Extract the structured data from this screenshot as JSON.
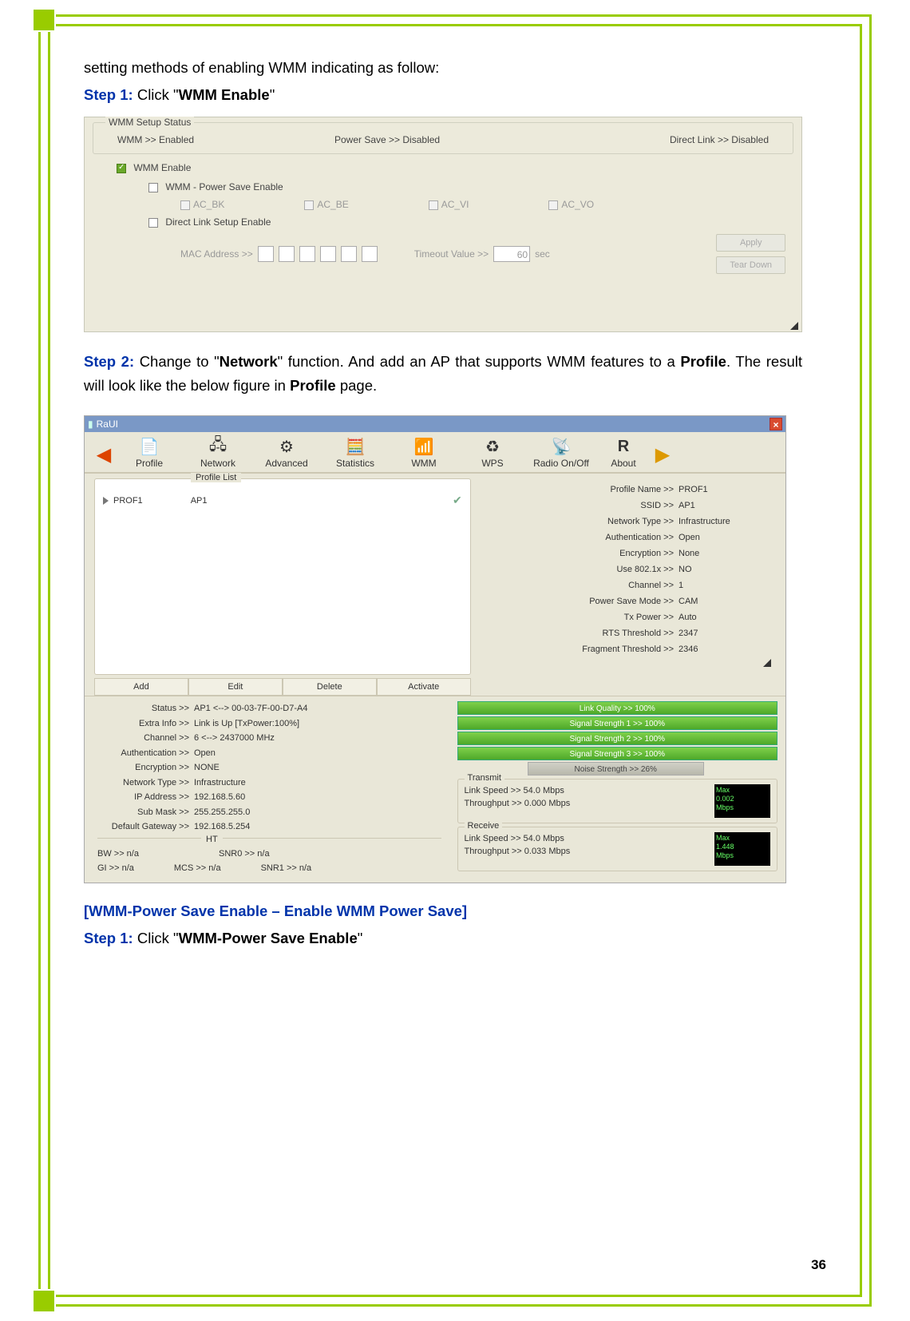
{
  "pageNumber": "36",
  "intro": "setting methods of enabling WMM indicating as follow:",
  "step1_prefix": "Step 1:",
  "step1_text": " Click \"",
  "step1_bold": "WMM Enable",
  "step1_suffix": "\"",
  "wmm": {
    "group": "WMM Setup Status",
    "status1": "WMM >> Enabled",
    "status2": "Power Save >> Disabled",
    "status3": "Direct Link >> Disabled",
    "enable": "WMM Enable",
    "psave": "WMM - Power Save Enable",
    "ac_bk": "AC_BK",
    "ac_be": "AC_BE",
    "ac_vi": "AC_VI",
    "ac_vo": "AC_VO",
    "dlink": "Direct Link Setup Enable",
    "mac": "MAC Address >>",
    "timeout": "Timeout Value >>",
    "timeoutVal": "60",
    "sec": "sec",
    "apply": "Apply",
    "tear": "Tear Down"
  },
  "step2_prefix": "Step 2:",
  "step2_a": " Change to \"",
  "step2_net": "Network",
  "step2_b": "\" function. And add an AP that supports WMM features to a ",
  "step2_prof": "Profile",
  "step2_c": ". The result will look like the below figure in ",
  "step2_prof2": "Profile",
  "step2_d": " page.",
  "raui": {
    "title": "RaUI",
    "tb": {
      "profile": "Profile",
      "network": "Network",
      "advanced": "Advanced",
      "stats": "Statistics",
      "wmm": "WMM",
      "wps": "WPS",
      "radio": "Radio On/Off",
      "about": "About"
    },
    "plistLabel": "Profile List",
    "row": {
      "name": "PROF1",
      "ap": "AP1"
    },
    "btns": {
      "add": "Add",
      "edit": "Edit",
      "del": "Delete",
      "act": "Activate"
    },
    "info": {
      "pname": "Profile Name >>",
      "pnameV": "PROF1",
      "ssid": "SSID >>",
      "ssidV": "AP1",
      "ntype": "Network Type >>",
      "ntypeV": "Infrastructure",
      "auth": "Authentication >>",
      "authV": "Open",
      "enc": "Encryption >>",
      "encV": "None",
      "use": "Use 802.1x >>",
      "useV": "NO",
      "ch": "Channel >>",
      "chV": "1",
      "psm": "Power Save Mode >>",
      "psmV": "CAM",
      "txp": "Tx Power >>",
      "txpV": "Auto",
      "rts": "RTS Threshold >>",
      "rtsV": "2347",
      "frag": "Fragment Threshold >>",
      "fragV": "2346"
    },
    "status": {
      "s1l": "Status >>",
      "s1v": "AP1 <--> 00-03-7F-00-D7-A4",
      "s2l": "Extra Info >>",
      "s2v": "Link is Up [TxPower:100%]",
      "s3l": "Channel >>",
      "s3v": "6 <--> 2437000 MHz",
      "s4l": "Authentication >>",
      "s4v": "Open",
      "s5l": "Encryption >>",
      "s5v": "NONE",
      "s6l": "Network Type >>",
      "s6v": "Infrastructure",
      "s7l": "IP Address >>",
      "s7v": "192.168.5.60",
      "s8l": "Sub Mask >>",
      "s8v": "255.255.255.0",
      "s9l": "Default Gateway >>",
      "s9v": "192.168.5.254",
      "ht": "HT",
      "bw": "BW >> n/a",
      "gi": "GI >> n/a",
      "mcs": "MCS >> n/a",
      "snr0": "SNR0 >> n/a",
      "snr1": "SNR1 >> n/a"
    },
    "bars": {
      "lq": "Link Quality >> 100%",
      "ss1": "Signal Strength 1 >> 100%",
      "ss2": "Signal Strength 2 >> 100%",
      "ss3": "Signal Strength 3 >> 100%",
      "ns": "Noise Strength >> 26%"
    },
    "tx": {
      "label": "Transmit",
      "ls": "Link Speed >> 54.0 Mbps",
      "tp": "Throughput >> 0.000 Mbps",
      "chip1": "Max",
      "chip2": "0.002",
      "chip3": "Mbps"
    },
    "rx": {
      "label": "Receive",
      "ls": "Link Speed >> 54.0 Mbps",
      "tp": "Throughput >> 0.033 Mbps",
      "chip1": "Max",
      "chip2": "1.448",
      "chip3": "Mbps"
    }
  },
  "wmm_ps_title": "[WMM-Power Save Enable – Enable WMM Power Save]",
  "step1b_prefix": "Step 1:",
  "step1b_text": " Click \"",
  "step1b_bold": "WMM-Power Save Enable",
  "step1b_suffix": "\""
}
